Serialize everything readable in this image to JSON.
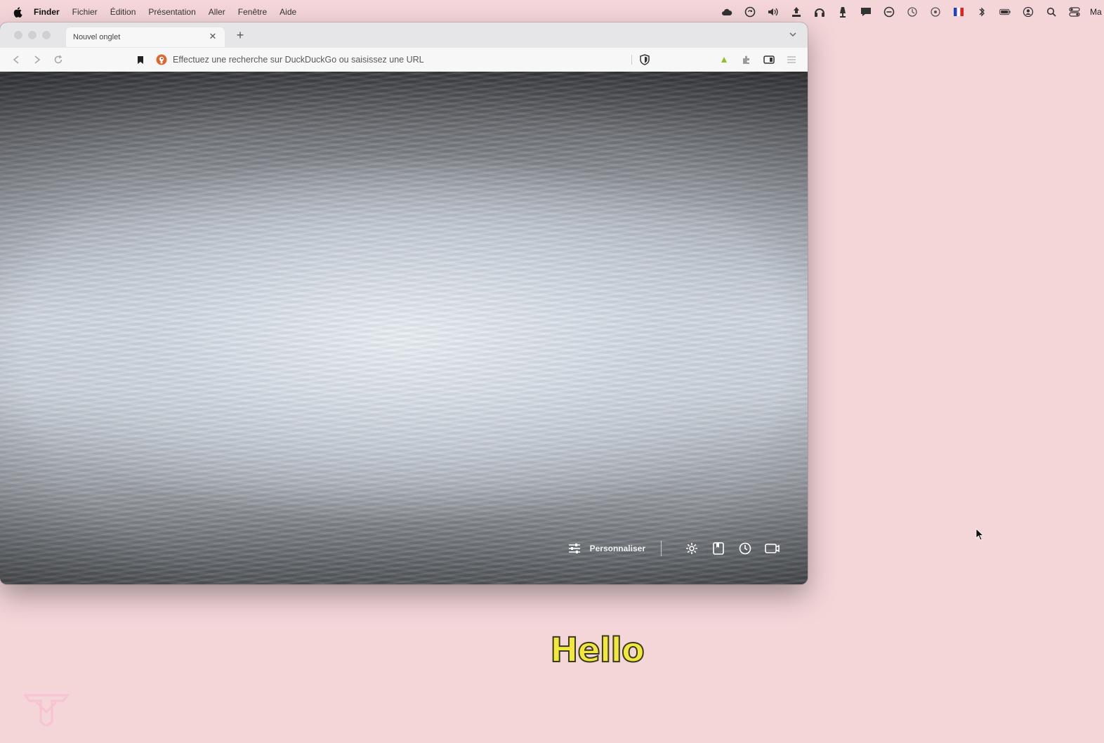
{
  "menubar": {
    "app_name": "Finder",
    "items": [
      "Fichier",
      "Édition",
      "Présentation",
      "Aller",
      "Fenêtre",
      "Aide"
    ],
    "status_icons": [
      "creative-cloud-icon",
      "sync-icon",
      "volume-icon",
      "upload-icon",
      "headphones-icon",
      "lamp-icon",
      "speech-bubble-icon",
      "minus-circle-icon",
      "time-machine-icon",
      "record-icon",
      "flag-fr-icon",
      "bluetooth-icon",
      "battery-icon",
      "user-icon",
      "search-icon",
      "control-center-icon"
    ],
    "clock_text": "Ma"
  },
  "browser": {
    "tab_title": "Nouvel onglet",
    "url_placeholder": "Effectuez une recherche sur DuckDuckGo ou saisissez une URL",
    "bottom_toolbar": {
      "customize_label": "Personnaliser"
    }
  },
  "caption": "Hello",
  "colors": {
    "desktop_bg": "#f4d6d9",
    "caption_fill": "#f2e83b",
    "caption_stroke": "#3a3a20",
    "ddg_orange": "#e0662b"
  }
}
